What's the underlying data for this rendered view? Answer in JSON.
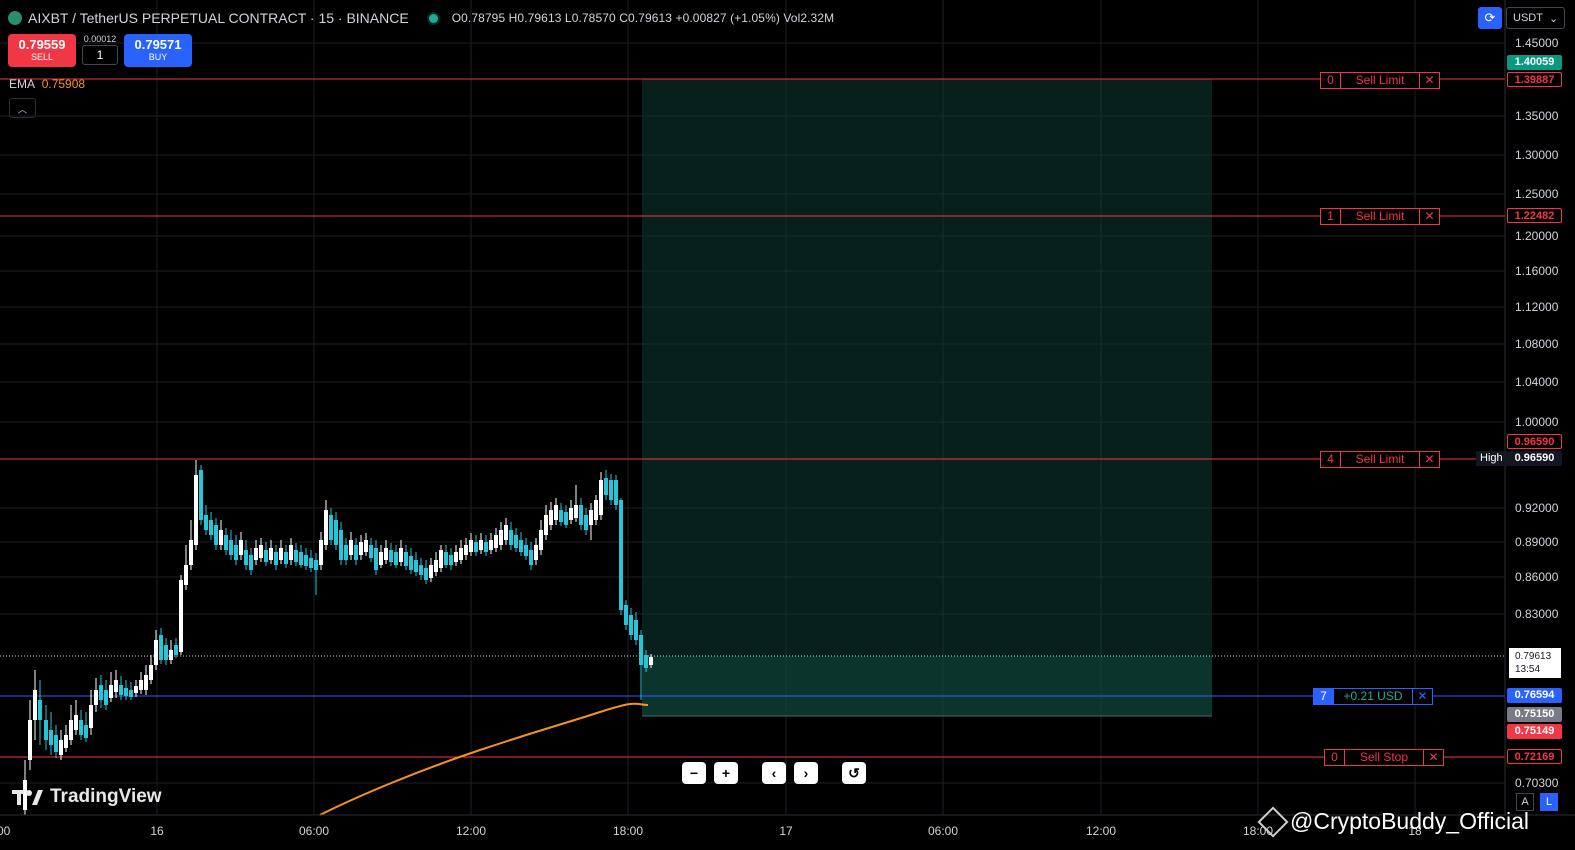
{
  "header": {
    "title": "AIXBT / TetherUS PERPETUAL CONTRACT · 15 · BINANCE",
    "ohlc": "O0.78795 H0.79613 L0.78570 C0.79613 +0.00827 (+1.05%) Vol2.32M"
  },
  "trade": {
    "sell_price": "0.79559",
    "sell_label": "SELL",
    "spread": "0.00012",
    "quantity": "1",
    "buy_price": "0.79571",
    "buy_label": "BUY"
  },
  "indicator": {
    "label": "EMA",
    "value": "0.75908"
  },
  "toolbar": {
    "currency": "USDT",
    "currency_chevron": "⌄",
    "sync_icon": "⟳"
  },
  "price_axis": {
    "labels": [
      "1.45000",
      "1.35000",
      "1.30000",
      "1.25000",
      "1.20000",
      "1.16000",
      "1.12000",
      "1.08000",
      "1.04000",
      "1.00000",
      "0.92000",
      "0.89000",
      "0.86000",
      "0.83000",
      "0.70300"
    ],
    "last_price": "0.79613",
    "countdown": "13:54"
  },
  "time_axis": {
    "labels": [
      ":00",
      "16",
      "06:00",
      "12:00",
      "18:00",
      "17",
      "06:00",
      "12:00",
      "18:00",
      "18"
    ]
  },
  "price_tags": {
    "tp_fill": "1.40059",
    "order0": "1.39887",
    "order1": "1.22482",
    "high_line": "0.96590",
    "high_line2": "0.96590",
    "position": "0.76594",
    "gray": "0.75150",
    "red": "0.75149",
    "stop": "0.72169"
  },
  "orders": [
    {
      "qty": "0",
      "type": "Sell Limit",
      "close": "✕"
    },
    {
      "qty": "1",
      "type": "Sell Limit",
      "close": "✕"
    },
    {
      "qty": "4",
      "type": "Sell Limit",
      "close": "✕"
    },
    {
      "qty": "0",
      "type": "Sell Stop",
      "close": "✕"
    }
  ],
  "position": {
    "qty": "7",
    "pnl": "+0.21 USD",
    "close": "✕"
  },
  "high_badge": "High",
  "nav": {
    "zoom_out": "−",
    "zoom_in": "+",
    "back": "‹",
    "forward": "›",
    "reset": "↺"
  },
  "logo": "TradingView",
  "watermark": "@CryptoBuddy_Official",
  "corner": {
    "auto": "A",
    "log": "L"
  },
  "colors": {
    "up": "#ffffff",
    "down": "#26c6da",
    "ema": "#f7931a",
    "order_line": "#f23645",
    "position_line": "#2962ff",
    "tp_zone": "#0d3b33"
  }
}
